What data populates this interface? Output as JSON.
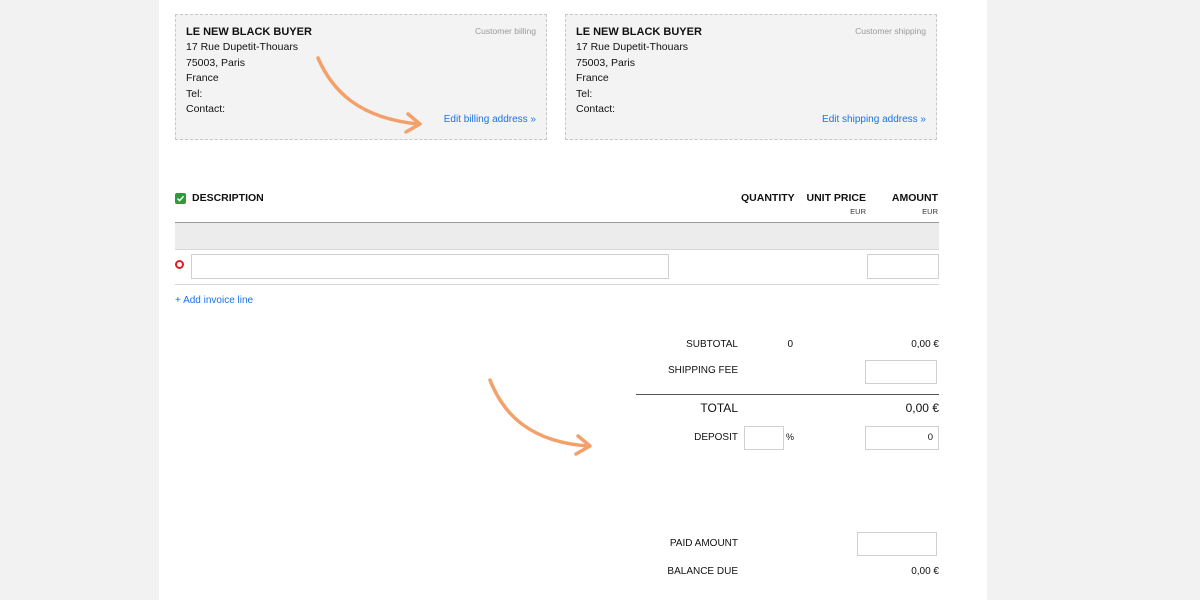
{
  "billing": {
    "name": "LE NEW BLACK BUYER",
    "street": "17 Rue Dupetit-Thouars",
    "city": "75003, Paris",
    "country": "France",
    "tel": "Tel:",
    "contact": "Contact:",
    "tag": "Customer billing",
    "edit_link": "Edit billing address »"
  },
  "shipping": {
    "name": "LE NEW BLACK BUYER",
    "street": "17 Rue Dupetit-Thouars",
    "city": "75003, Paris",
    "country": "France",
    "tel": "Tel:",
    "contact": "Contact:",
    "tag": "Customer shipping",
    "edit_link": "Edit shipping address »"
  },
  "table": {
    "description": "DESCRIPTION",
    "quantity": "QUANTITY",
    "unit_price": "UNIT PRICE",
    "unit_price_currency": "EUR",
    "amount": "AMOUNT",
    "amount_currency": "EUR",
    "add_line": "+ Add invoice line"
  },
  "totals": {
    "subtotal_label": "SUBTOTAL",
    "subtotal_qty": "0",
    "subtotal_value": "0,00 €",
    "shipping_fee_label": "SHIPPING FEE",
    "total_label": "TOTAL",
    "total_value": "0,00 €",
    "deposit_label": "DEPOSIT",
    "deposit_pct_symbol": "%",
    "deposit_value": "0",
    "paid_amount_label": "PAID AMOUNT",
    "balance_due_label": "BALANCE DUE",
    "balance_due_value": "0,00 €"
  },
  "colors": {
    "link": "#1a73e8",
    "arrow": "#f4a06b",
    "checkbox": "#2e9b3a",
    "remove": "#e02020"
  },
  "icons": {
    "checkbox": "checkbox-checked-icon",
    "remove": "remove-circle-icon",
    "arrow": "curved-arrow-icon"
  }
}
